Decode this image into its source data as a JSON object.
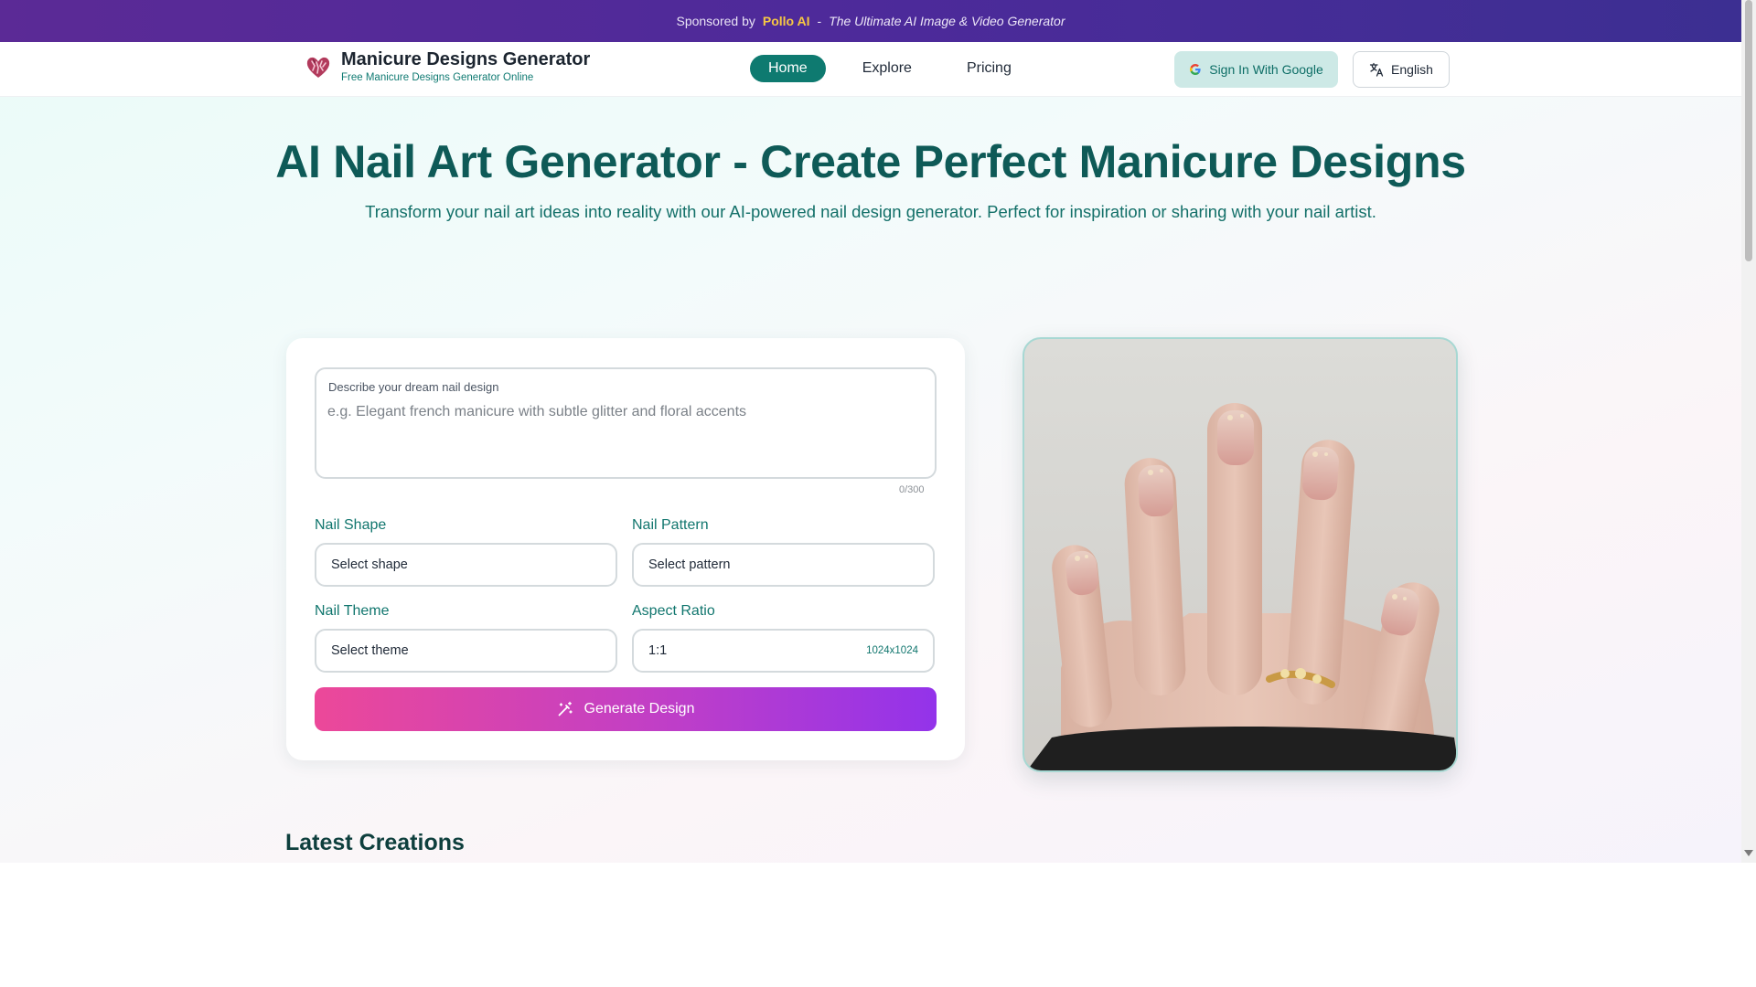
{
  "sponsor": {
    "prefix": "Sponsored by",
    "brand": "Pollo AI",
    "separator": "-",
    "tagline": "The Ultimate AI Image & Video Generator"
  },
  "header": {
    "title": "Manicure Designs Generator",
    "subtitle": "Free Manicure Designs Generator Online",
    "nav": [
      {
        "label": "Home",
        "active": true
      },
      {
        "label": "Explore",
        "active": false
      },
      {
        "label": "Pricing",
        "active": false
      }
    ],
    "sign_in_label": "Sign In With Google",
    "language_label": "English"
  },
  "hero": {
    "title": "AI Nail Art Generator - Create Perfect Manicure Designs",
    "subtitle": "Transform your nail art ideas into reality with our AI-powered nail design generator. Perfect for inspiration or sharing with your nail artist."
  },
  "form": {
    "prompt_label": "Describe your dream nail design",
    "prompt_placeholder": "e.g. Elegant french manicure with subtle glitter and floral accents",
    "prompt_value": "",
    "counter": "0/300",
    "shape_label": "Nail Shape",
    "shape_value": "Select shape",
    "pattern_label": "Nail Pattern",
    "pattern_value": "Select pattern",
    "theme_label": "Nail Theme",
    "theme_value": "Select theme",
    "ratio_label": "Aspect Ratio",
    "ratio_value": "1:1",
    "ratio_resolution": "1024x1024",
    "generate_label": "Generate Design"
  },
  "latest": {
    "title": "Latest Creations"
  },
  "colors": {
    "brand_teal": "#0e7a70",
    "sponsor_purple": "#5b2a96",
    "pollo_yellow": "#f7c842",
    "generate_start": "#ec4899",
    "generate_end": "#9333ea"
  },
  "icons": {
    "logo": "heart-logo-icon",
    "google": "google-icon",
    "language": "translate-icon",
    "generate": "magic-wand-icon"
  }
}
